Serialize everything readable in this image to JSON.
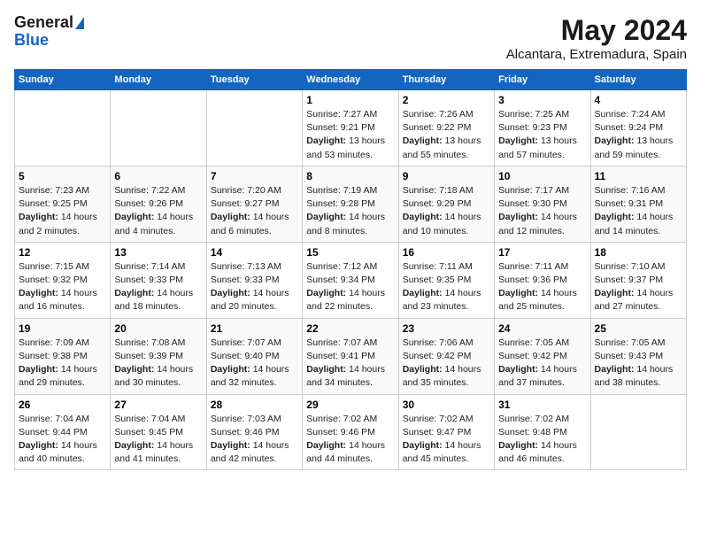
{
  "logo": {
    "general": "General",
    "blue": "Blue"
  },
  "header": {
    "month": "May 2024",
    "location": "Alcantara, Extremadura, Spain"
  },
  "weekdays": [
    "Sunday",
    "Monday",
    "Tuesday",
    "Wednesday",
    "Thursday",
    "Friday",
    "Saturday"
  ],
  "weeks": [
    [
      {
        "day": "",
        "info": ""
      },
      {
        "day": "",
        "info": ""
      },
      {
        "day": "",
        "info": ""
      },
      {
        "day": "1",
        "info": "Sunrise: 7:27 AM\nSunset: 9:21 PM\nDaylight: 13 hours and 53 minutes."
      },
      {
        "day": "2",
        "info": "Sunrise: 7:26 AM\nSunset: 9:22 PM\nDaylight: 13 hours and 55 minutes."
      },
      {
        "day": "3",
        "info": "Sunrise: 7:25 AM\nSunset: 9:23 PM\nDaylight: 13 hours and 57 minutes."
      },
      {
        "day": "4",
        "info": "Sunrise: 7:24 AM\nSunset: 9:24 PM\nDaylight: 13 hours and 59 minutes."
      }
    ],
    [
      {
        "day": "5",
        "info": "Sunrise: 7:23 AM\nSunset: 9:25 PM\nDaylight: 14 hours and 2 minutes."
      },
      {
        "day": "6",
        "info": "Sunrise: 7:22 AM\nSunset: 9:26 PM\nDaylight: 14 hours and 4 minutes."
      },
      {
        "day": "7",
        "info": "Sunrise: 7:20 AM\nSunset: 9:27 PM\nDaylight: 14 hours and 6 minutes."
      },
      {
        "day": "8",
        "info": "Sunrise: 7:19 AM\nSunset: 9:28 PM\nDaylight: 14 hours and 8 minutes."
      },
      {
        "day": "9",
        "info": "Sunrise: 7:18 AM\nSunset: 9:29 PM\nDaylight: 14 hours and 10 minutes."
      },
      {
        "day": "10",
        "info": "Sunrise: 7:17 AM\nSunset: 9:30 PM\nDaylight: 14 hours and 12 minutes."
      },
      {
        "day": "11",
        "info": "Sunrise: 7:16 AM\nSunset: 9:31 PM\nDaylight: 14 hours and 14 minutes."
      }
    ],
    [
      {
        "day": "12",
        "info": "Sunrise: 7:15 AM\nSunset: 9:32 PM\nDaylight: 14 hours and 16 minutes."
      },
      {
        "day": "13",
        "info": "Sunrise: 7:14 AM\nSunset: 9:33 PM\nDaylight: 14 hours and 18 minutes."
      },
      {
        "day": "14",
        "info": "Sunrise: 7:13 AM\nSunset: 9:33 PM\nDaylight: 14 hours and 20 minutes."
      },
      {
        "day": "15",
        "info": "Sunrise: 7:12 AM\nSunset: 9:34 PM\nDaylight: 14 hours and 22 minutes."
      },
      {
        "day": "16",
        "info": "Sunrise: 7:11 AM\nSunset: 9:35 PM\nDaylight: 14 hours and 23 minutes."
      },
      {
        "day": "17",
        "info": "Sunrise: 7:11 AM\nSunset: 9:36 PM\nDaylight: 14 hours and 25 minutes."
      },
      {
        "day": "18",
        "info": "Sunrise: 7:10 AM\nSunset: 9:37 PM\nDaylight: 14 hours and 27 minutes."
      }
    ],
    [
      {
        "day": "19",
        "info": "Sunrise: 7:09 AM\nSunset: 9:38 PM\nDaylight: 14 hours and 29 minutes."
      },
      {
        "day": "20",
        "info": "Sunrise: 7:08 AM\nSunset: 9:39 PM\nDaylight: 14 hours and 30 minutes."
      },
      {
        "day": "21",
        "info": "Sunrise: 7:07 AM\nSunset: 9:40 PM\nDaylight: 14 hours and 32 minutes."
      },
      {
        "day": "22",
        "info": "Sunrise: 7:07 AM\nSunset: 9:41 PM\nDaylight: 14 hours and 34 minutes."
      },
      {
        "day": "23",
        "info": "Sunrise: 7:06 AM\nSunset: 9:42 PM\nDaylight: 14 hours and 35 minutes."
      },
      {
        "day": "24",
        "info": "Sunrise: 7:05 AM\nSunset: 9:42 PM\nDaylight: 14 hours and 37 minutes."
      },
      {
        "day": "25",
        "info": "Sunrise: 7:05 AM\nSunset: 9:43 PM\nDaylight: 14 hours and 38 minutes."
      }
    ],
    [
      {
        "day": "26",
        "info": "Sunrise: 7:04 AM\nSunset: 9:44 PM\nDaylight: 14 hours and 40 minutes."
      },
      {
        "day": "27",
        "info": "Sunrise: 7:04 AM\nSunset: 9:45 PM\nDaylight: 14 hours and 41 minutes."
      },
      {
        "day": "28",
        "info": "Sunrise: 7:03 AM\nSunset: 9:46 PM\nDaylight: 14 hours and 42 minutes."
      },
      {
        "day": "29",
        "info": "Sunrise: 7:02 AM\nSunset: 9:46 PM\nDaylight: 14 hours and 44 minutes."
      },
      {
        "day": "30",
        "info": "Sunrise: 7:02 AM\nSunset: 9:47 PM\nDaylight: 14 hours and 45 minutes."
      },
      {
        "day": "31",
        "info": "Sunrise: 7:02 AM\nSunset: 9:48 PM\nDaylight: 14 hours and 46 minutes."
      },
      {
        "day": "",
        "info": ""
      }
    ]
  ]
}
